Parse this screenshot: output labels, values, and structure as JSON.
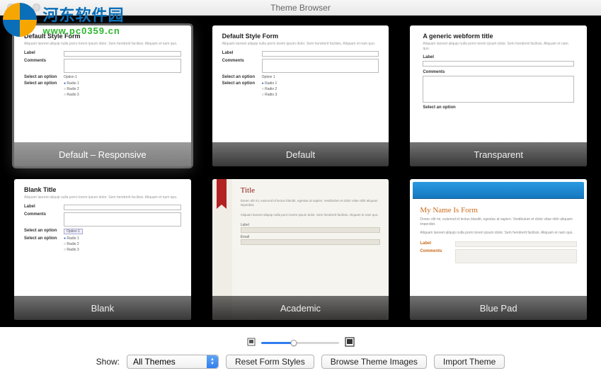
{
  "window": {
    "title": "Theme Browser"
  },
  "watermark": {
    "cn": "河东软件园",
    "url": "www.pc0359.cn"
  },
  "themes": [
    {
      "label": "Default – Responsive",
      "selected": true,
      "preview_title": "Default Style Form"
    },
    {
      "label": "Default",
      "selected": false,
      "preview_title": "Default Style Form"
    },
    {
      "label": "Transparent",
      "selected": false,
      "preview_title": "A generic webform title"
    },
    {
      "label": "Blank",
      "selected": false,
      "preview_title": "Blank Title"
    },
    {
      "label": "Academic",
      "selected": false,
      "preview_title": "Title"
    },
    {
      "label": "Blue Pad",
      "selected": false,
      "preview_title": "My Name Is Form"
    }
  ],
  "preview_fields": {
    "label": "Label",
    "comments": "Comments",
    "select_option": "Select an option",
    "option1": "Option 1",
    "radio1": "Radio 1",
    "radio2": "Radio 2",
    "radio3": "Radio 3",
    "lorem": "Aliquam laoreet aliquip nulla porro lorem ipsum dolor. Sem hendrerit facilisis. Aliquam et nam quo.",
    "lorem_long": "Donec elit mi, euismod id lectus blandit, egestas at sapien. Vestibulum et dolor vitae nibh aliquam imperdiet.",
    "email": "Email"
  },
  "controls": {
    "show_label": "Show:",
    "filter_value": "All Themes",
    "reset_label": "Reset Form Styles",
    "browse_label": "Browse Theme Images",
    "import_label": "Import Theme"
  },
  "zoom": {
    "percent": 42
  }
}
